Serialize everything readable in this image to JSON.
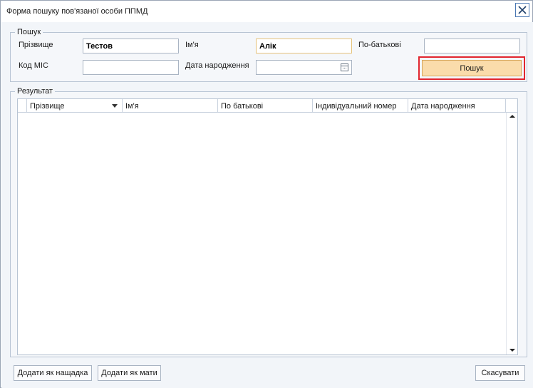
{
  "window": {
    "title": "Форма пошуку пов'язаної особи ППМД"
  },
  "search": {
    "legend": "Пошук",
    "surname_label": "Прізвище",
    "surname_value": "Тестов",
    "name_label": "Ім'я",
    "name_value": "Алік",
    "patronymic_label": "По-батькові",
    "patronymic_value": "",
    "mis_code_label": "Код МІС",
    "mis_code_value": "",
    "birthdate_label": "Дата народження",
    "birthdate_value": "",
    "search_button": "Пошук"
  },
  "result": {
    "legend": "Результат",
    "columns": [
      "Прізвище",
      "Ім'я",
      "По батькові",
      "Індивідуальний номер",
      "Дата народження"
    ],
    "rows": []
  },
  "footer": {
    "add_as_child": "Додати як нащадка",
    "add_as_mother": "Додати як мати",
    "cancel": "Скасувати"
  },
  "colors": {
    "search_button_bg": "#fadcab",
    "highlight_border": "#e1262f",
    "close_button_border": "#4a78b3"
  }
}
